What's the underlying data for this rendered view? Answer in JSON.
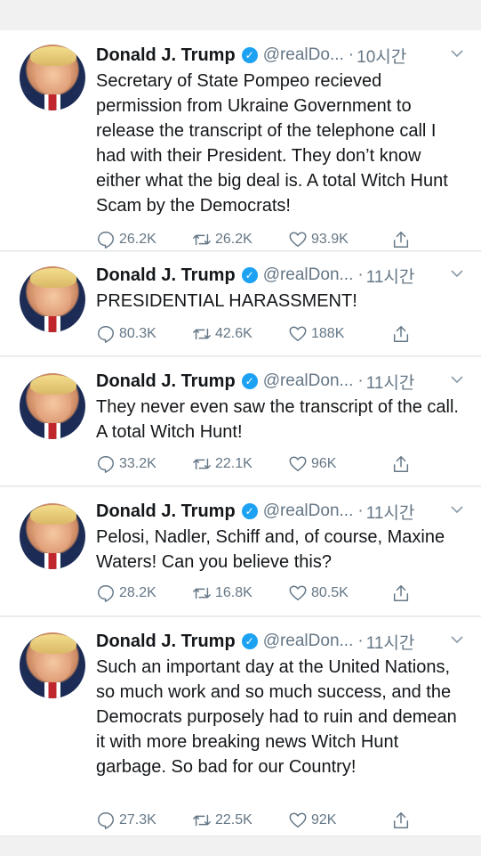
{
  "tweets": [
    {
      "name": "Donald J. Trump",
      "handle": "@realDo...",
      "time": "10시간",
      "text": "Secretary of State Pompeo recieved permission from Ukraine Government to release the transcript of the telephone call I had with their President. They don’t know either what the big deal is. A total Witch Hunt Scam by the Democrats!",
      "replies": "26.2K",
      "retweets": "26.2K",
      "likes": "93.9K"
    },
    {
      "name": "Donald J. Trump",
      "handle": "@realDon...",
      "time": "11시간",
      "text": "PRESIDENTIAL HARASSMENT!",
      "replies": "80.3K",
      "retweets": "42.6K",
      "likes": "188K"
    },
    {
      "name": "Donald J. Trump",
      "handle": "@realDon...",
      "time": "11시간",
      "text": "They never even saw the transcript of the call. A total Witch Hunt!",
      "replies": "33.2K",
      "retweets": "22.1K",
      "likes": "96K"
    },
    {
      "name": "Donald J. Trump",
      "handle": "@realDon...",
      "time": "11시간",
      "text": "Pelosi, Nadler, Schiff and, of course, Maxine Waters! Can you believe this?",
      "replies": "28.2K",
      "retweets": "16.8K",
      "likes": "80.5K"
    },
    {
      "name": "Donald J. Trump",
      "handle": "@realDon...",
      "time": "11시간",
      "text": "Such an important day at the United Nations, so much work and so much success, and the Democrats purposely had to ruin and demean it with more breaking news Witch Hunt garbage. So bad for our Country!",
      "replies": "27.3K",
      "retweets": "22.5K",
      "likes": "92K"
    }
  ],
  "icons": {
    "reply": "reply-icon",
    "retweet": "retweet-icon",
    "like": "heart-icon",
    "share": "share-icon",
    "verified": "verified-badge-icon",
    "menu": "chevron-down-icon"
  },
  "colors": {
    "text": "#14171a",
    "secondary": "#657786",
    "verified": "#1da1f2",
    "background": "#f1f1f1",
    "card": "#ffffff"
  }
}
